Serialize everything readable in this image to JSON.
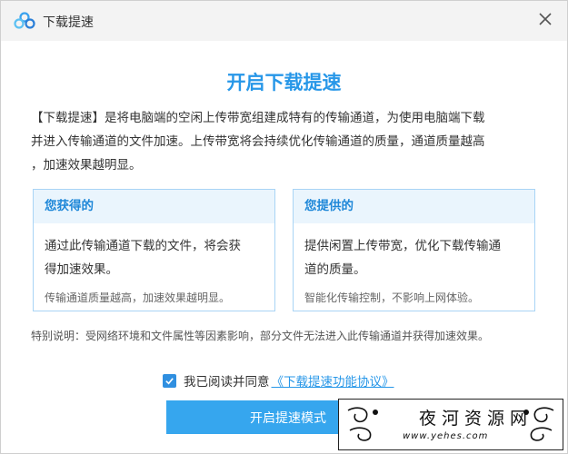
{
  "window": {
    "title": "下载提速",
    "icons": {
      "logo": "baidu-netdisk-cloud-icon",
      "close": "close-icon",
      "check": "check-icon"
    }
  },
  "content": {
    "headline": "开启下载提速",
    "intro_lines": [
      "【下载提速】是将电脑端的空闲上传带宽组建成特有的传输通道，为使用电脑端下载",
      "并进入传输通道的文件加速。上传带宽将会持续优化传输通道的质量，通道质量越高",
      "，加速效果越明显。"
    ],
    "cards": [
      {
        "title": "您获得的",
        "body_lines": [
          "通过此传输通道下载的文件，将会获",
          "得加速效果。"
        ],
        "note": "传输通道质量越高，加速效果越明显。"
      },
      {
        "title": "您提供的",
        "body_lines": [
          "提供闲置上传带宽，优化下载传输通",
          "道的质量。"
        ],
        "note": "智能化传输控制，不影响上网体验。"
      }
    ],
    "notice": "特别说明：受网络环境和文件属性等因素影响，部分文件无法进入此传输通道并获得加速效果。",
    "agreement": {
      "checked": true,
      "label": "我已阅读并同意",
      "link_text": "《下载提速功能协议》"
    },
    "button_label": "开启提速模式"
  },
  "watermark": {
    "brand": "夜河资源网",
    "url": "www.yehes.com"
  },
  "colors": {
    "accent": "#2797e8",
    "button": "#36a6ee",
    "card_header_bg": "#eaf5fd",
    "card_border": "#a9d4f5"
  }
}
